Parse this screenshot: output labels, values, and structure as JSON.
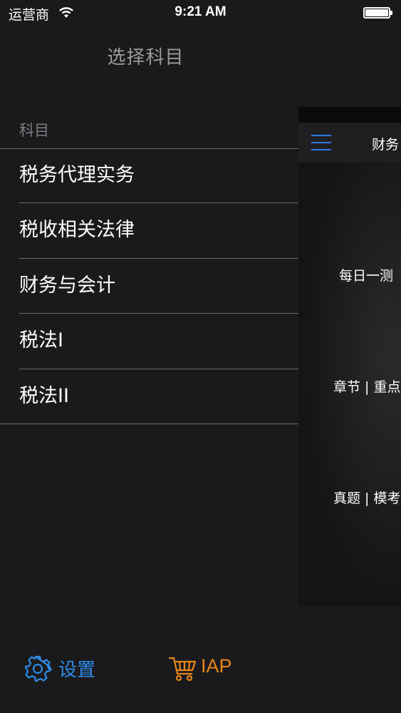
{
  "status_bar": {
    "carrier": "运营商",
    "time": "9:21 AM"
  },
  "menu": {
    "title": "选择科目",
    "section_header": "科目",
    "items": [
      {
        "label": "税务代理实务"
      },
      {
        "label": "税收相关法律"
      },
      {
        "label": "财务与会计"
      },
      {
        "label": "税法I"
      },
      {
        "label": "税法II"
      }
    ]
  },
  "preview": {
    "nav_title": "财务",
    "buttons": [
      {
        "label": "每日一测"
      },
      {
        "label": "章节 | 重点"
      },
      {
        "label": "真题 | 模考"
      }
    ]
  },
  "toolbar": {
    "settings_label": "设置",
    "iap_label": "IAP"
  },
  "colors": {
    "background": "#1a1a1c",
    "accent_blue": "#2d8be6",
    "accent_orange": "#e8861a"
  },
  "icons": [
    "wifi-icon",
    "battery-icon",
    "hamburger-icon",
    "gear-icon",
    "cart-icon"
  ]
}
